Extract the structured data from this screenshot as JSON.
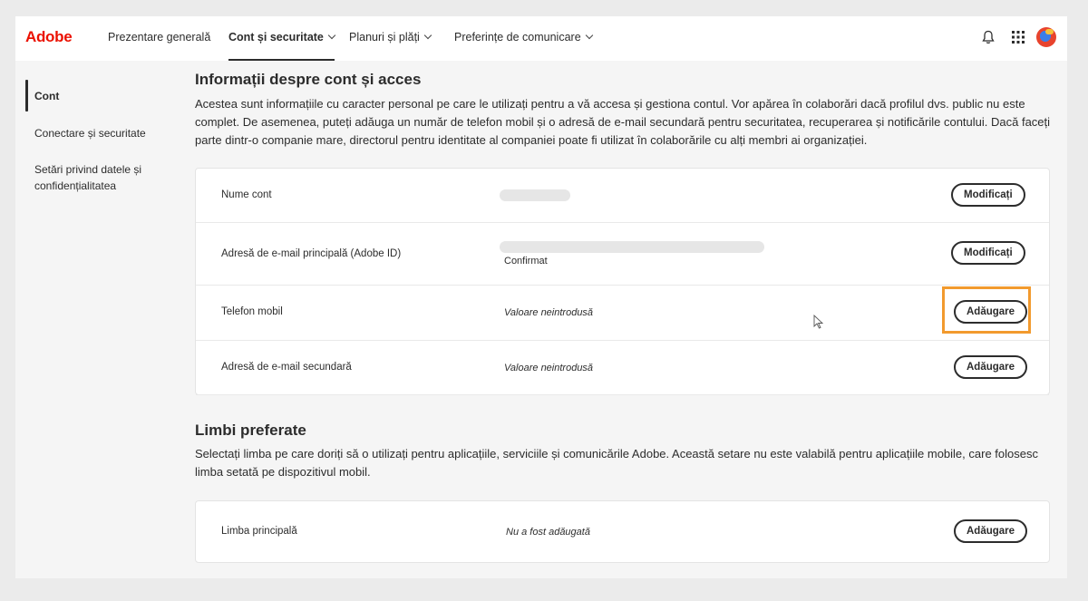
{
  "header": {
    "logo": "Adobe",
    "nav": [
      {
        "label": "Prezentare generală",
        "active": false,
        "dropdown": false
      },
      {
        "label": "Cont și securitate",
        "active": true,
        "dropdown": true
      },
      {
        "label": "Planuri și plăți",
        "active": false,
        "dropdown": true
      },
      {
        "label": "Preferințe de comunicare",
        "active": false,
        "dropdown": true
      }
    ],
    "icons": [
      "bell-icon",
      "apps-grid-icon",
      "avatar"
    ]
  },
  "sidebar": {
    "items": [
      {
        "label": "Cont",
        "active": true
      },
      {
        "label": "Conectare și securitate",
        "active": false
      },
      {
        "label": "Setări privind datele și confidențialitatea",
        "active": false
      }
    ]
  },
  "account": {
    "title": "Informații despre cont și acces",
    "description": "Acestea sunt informațiile cu caracter personal pe care le utilizați pentru a vă accesa și gestiona contul. Vor apărea în colaborări dacă profilul dvs. public nu este complet. De asemenea, puteți adăuga un număr de telefon mobil și o adresă de e-mail secundară pentru securitatea, recuperarea și notificările contului. Dacă faceți parte dintr-o companie mare, directorul pentru identitate al companiei poate fi utilizat în colaborările cu alți membri ai organizației.",
    "rows": [
      {
        "label": "Nume cont",
        "value": "",
        "sub": "",
        "button": "Modificați"
      },
      {
        "label": "Adresă de e-mail principală (Adobe ID)",
        "value": "",
        "sub": "Confirmat",
        "button": "Modificați"
      },
      {
        "label": "Telefon mobil",
        "value": "Valoare neintrodusă",
        "sub": "",
        "button": "Adăugare"
      },
      {
        "label": "Adresă de e-mail secundară",
        "value": "Valoare neintrodusă",
        "sub": "",
        "button": "Adăugare"
      }
    ]
  },
  "languages": {
    "title": "Limbi preferate",
    "description": "Selectați limba pe care doriți să o utilizați pentru aplicațiile, serviciile și comunicările Adobe. Această setare nu este valabilă pentru aplicațiile mobile, care folosesc limba setată pe dispozitivul mobil.",
    "rows": [
      {
        "label": "Limba principală",
        "value": "Nu a fost adăugată",
        "button": "Adăugare"
      }
    ]
  },
  "colors": {
    "brand": "#eb1000",
    "highlight": "#f29a2e",
    "text": "#2c2c2c"
  }
}
